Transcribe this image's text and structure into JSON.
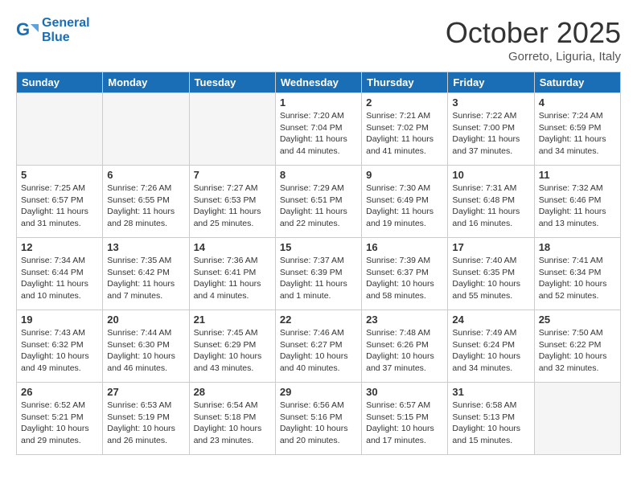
{
  "header": {
    "logo_line1": "General",
    "logo_line2": "Blue",
    "month": "October 2025",
    "location": "Gorreto, Liguria, Italy"
  },
  "days_of_week": [
    "Sunday",
    "Monday",
    "Tuesday",
    "Wednesday",
    "Thursday",
    "Friday",
    "Saturday"
  ],
  "weeks": [
    [
      {
        "num": "",
        "text": "",
        "empty": true
      },
      {
        "num": "",
        "text": "",
        "empty": true
      },
      {
        "num": "",
        "text": "",
        "empty": true
      },
      {
        "num": "1",
        "text": "Sunrise: 7:20 AM\nSunset: 7:04 PM\nDaylight: 11 hours\nand 44 minutes."
      },
      {
        "num": "2",
        "text": "Sunrise: 7:21 AM\nSunset: 7:02 PM\nDaylight: 11 hours\nand 41 minutes."
      },
      {
        "num": "3",
        "text": "Sunrise: 7:22 AM\nSunset: 7:00 PM\nDaylight: 11 hours\nand 37 minutes."
      },
      {
        "num": "4",
        "text": "Sunrise: 7:24 AM\nSunset: 6:59 PM\nDaylight: 11 hours\nand 34 minutes."
      }
    ],
    [
      {
        "num": "5",
        "text": "Sunrise: 7:25 AM\nSunset: 6:57 PM\nDaylight: 11 hours\nand 31 minutes."
      },
      {
        "num": "6",
        "text": "Sunrise: 7:26 AM\nSunset: 6:55 PM\nDaylight: 11 hours\nand 28 minutes."
      },
      {
        "num": "7",
        "text": "Sunrise: 7:27 AM\nSunset: 6:53 PM\nDaylight: 11 hours\nand 25 minutes."
      },
      {
        "num": "8",
        "text": "Sunrise: 7:29 AM\nSunset: 6:51 PM\nDaylight: 11 hours\nand 22 minutes."
      },
      {
        "num": "9",
        "text": "Sunrise: 7:30 AM\nSunset: 6:49 PM\nDaylight: 11 hours\nand 19 minutes."
      },
      {
        "num": "10",
        "text": "Sunrise: 7:31 AM\nSunset: 6:48 PM\nDaylight: 11 hours\nand 16 minutes."
      },
      {
        "num": "11",
        "text": "Sunrise: 7:32 AM\nSunset: 6:46 PM\nDaylight: 11 hours\nand 13 minutes."
      }
    ],
    [
      {
        "num": "12",
        "text": "Sunrise: 7:34 AM\nSunset: 6:44 PM\nDaylight: 11 hours\nand 10 minutes."
      },
      {
        "num": "13",
        "text": "Sunrise: 7:35 AM\nSunset: 6:42 PM\nDaylight: 11 hours\nand 7 minutes."
      },
      {
        "num": "14",
        "text": "Sunrise: 7:36 AM\nSunset: 6:41 PM\nDaylight: 11 hours\nand 4 minutes."
      },
      {
        "num": "15",
        "text": "Sunrise: 7:37 AM\nSunset: 6:39 PM\nDaylight: 11 hours\nand 1 minute."
      },
      {
        "num": "16",
        "text": "Sunrise: 7:39 AM\nSunset: 6:37 PM\nDaylight: 10 hours\nand 58 minutes."
      },
      {
        "num": "17",
        "text": "Sunrise: 7:40 AM\nSunset: 6:35 PM\nDaylight: 10 hours\nand 55 minutes."
      },
      {
        "num": "18",
        "text": "Sunrise: 7:41 AM\nSunset: 6:34 PM\nDaylight: 10 hours\nand 52 minutes."
      }
    ],
    [
      {
        "num": "19",
        "text": "Sunrise: 7:43 AM\nSunset: 6:32 PM\nDaylight: 10 hours\nand 49 minutes."
      },
      {
        "num": "20",
        "text": "Sunrise: 7:44 AM\nSunset: 6:30 PM\nDaylight: 10 hours\nand 46 minutes."
      },
      {
        "num": "21",
        "text": "Sunrise: 7:45 AM\nSunset: 6:29 PM\nDaylight: 10 hours\nand 43 minutes."
      },
      {
        "num": "22",
        "text": "Sunrise: 7:46 AM\nSunset: 6:27 PM\nDaylight: 10 hours\nand 40 minutes."
      },
      {
        "num": "23",
        "text": "Sunrise: 7:48 AM\nSunset: 6:26 PM\nDaylight: 10 hours\nand 37 minutes."
      },
      {
        "num": "24",
        "text": "Sunrise: 7:49 AM\nSunset: 6:24 PM\nDaylight: 10 hours\nand 34 minutes."
      },
      {
        "num": "25",
        "text": "Sunrise: 7:50 AM\nSunset: 6:22 PM\nDaylight: 10 hours\nand 32 minutes."
      }
    ],
    [
      {
        "num": "26",
        "text": "Sunrise: 6:52 AM\nSunset: 5:21 PM\nDaylight: 10 hours\nand 29 minutes."
      },
      {
        "num": "27",
        "text": "Sunrise: 6:53 AM\nSunset: 5:19 PM\nDaylight: 10 hours\nand 26 minutes."
      },
      {
        "num": "28",
        "text": "Sunrise: 6:54 AM\nSunset: 5:18 PM\nDaylight: 10 hours\nand 23 minutes."
      },
      {
        "num": "29",
        "text": "Sunrise: 6:56 AM\nSunset: 5:16 PM\nDaylight: 10 hours\nand 20 minutes."
      },
      {
        "num": "30",
        "text": "Sunrise: 6:57 AM\nSunset: 5:15 PM\nDaylight: 10 hours\nand 17 minutes."
      },
      {
        "num": "31",
        "text": "Sunrise: 6:58 AM\nSunset: 5:13 PM\nDaylight: 10 hours\nand 15 minutes."
      },
      {
        "num": "",
        "text": "",
        "empty": true
      }
    ]
  ]
}
